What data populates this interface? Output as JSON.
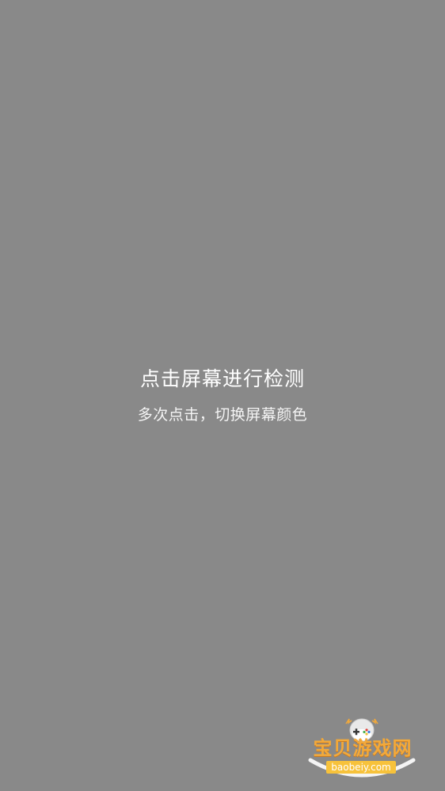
{
  "screen": {
    "background_color": "#898989",
    "title": "点击屏幕进行检测",
    "subtitle": "多次点击，切换屏幕颜色"
  },
  "watermark": {
    "logo_text": "宝贝游戏网",
    "url_text": "baobeiy.com",
    "accent_color": "#f2a93b"
  }
}
